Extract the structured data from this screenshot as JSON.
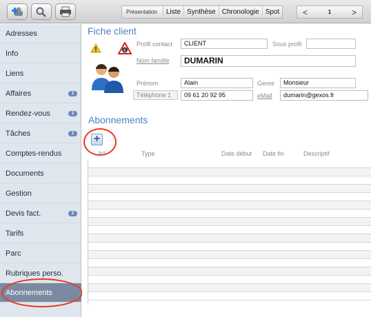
{
  "toolbar": {
    "tabs": [
      "Présentation",
      "Liste",
      "Synthèse",
      "Chronologie",
      "Spot"
    ],
    "pager": {
      "prev": "<",
      "page": "1",
      "next": ">"
    },
    "icons": [
      "add-user-icon",
      "search-icon",
      "print-icon"
    ]
  },
  "sidebar": {
    "items": [
      {
        "label": "Adresses"
      },
      {
        "label": "Info"
      },
      {
        "label": "Liens"
      },
      {
        "label": "Affaires",
        "badge": "1"
      },
      {
        "label": "Rendez-vous",
        "badge": "1"
      },
      {
        "label": "Tâches",
        "badge": "1"
      },
      {
        "label": "Comptes-rendus"
      },
      {
        "label": "Documents"
      },
      {
        "label": "Gestion"
      },
      {
        "label": "Devis fact.",
        "badge": "2"
      },
      {
        "label": "Tarifs"
      },
      {
        "label": "Parc"
      },
      {
        "label": "Rubriques perso."
      },
      {
        "label": "Abonnements",
        "active": true
      }
    ]
  },
  "fiche": {
    "title": "Fiche client",
    "profil_contact_label": "Profil contact",
    "profil_contact_value": "CLIENT",
    "sous_profil_label": "Sous profil",
    "sous_profil_value": "",
    "nom_famille_label": "Nom famille",
    "nom_famille_value": "DUMARIN",
    "prenom_label": "Prénom",
    "prenom_value": "Alain",
    "genre_label": "Genre",
    "genre_value": "Monsieur",
    "telephone_label": "Téléphone 1",
    "telephone_value": "09 61 20 92 95",
    "email_label": "eMail",
    "email_value": "dumarin@gexos.fr"
  },
  "abonnements": {
    "title": "Abonnements",
    "add_label": "+",
    "columns": [
      "N°",
      "Type",
      "Date début",
      "Date fin",
      "Descriptif"
    ],
    "rows": []
  },
  "colors": {
    "accent": "#4a82c4",
    "highlight_ring": "#e53a23",
    "sidebar_bg": "#e0e6ee",
    "sidebar_active": "#7b8aa0"
  }
}
